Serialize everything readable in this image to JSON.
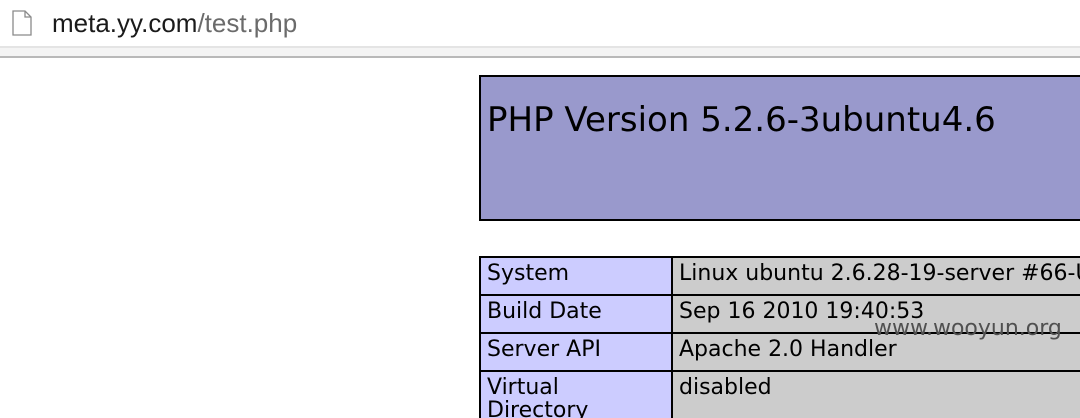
{
  "browser": {
    "url_host": "meta.yy.com",
    "url_path": "/test.php",
    "icon": "page-icon"
  },
  "page": {
    "title": "PHP Version 5.2.6-3ubuntu4.6",
    "rows": [
      {
        "label": "System",
        "value": "Linux ubuntu 2.6.28-19-server #66-U"
      },
      {
        "label": "Build Date",
        "value": "Sep 16 2010 19:40:53"
      },
      {
        "label": "Server API",
        "value": "Apache 2.0 Handler"
      },
      {
        "label": "Virtual Directory",
        "value": "disabled"
      }
    ]
  },
  "watermark": "www.wooyun.org",
  "colors": {
    "header_bg": "#9999cc",
    "label_bg": "#ccccff",
    "value_bg": "#cccccc"
  }
}
